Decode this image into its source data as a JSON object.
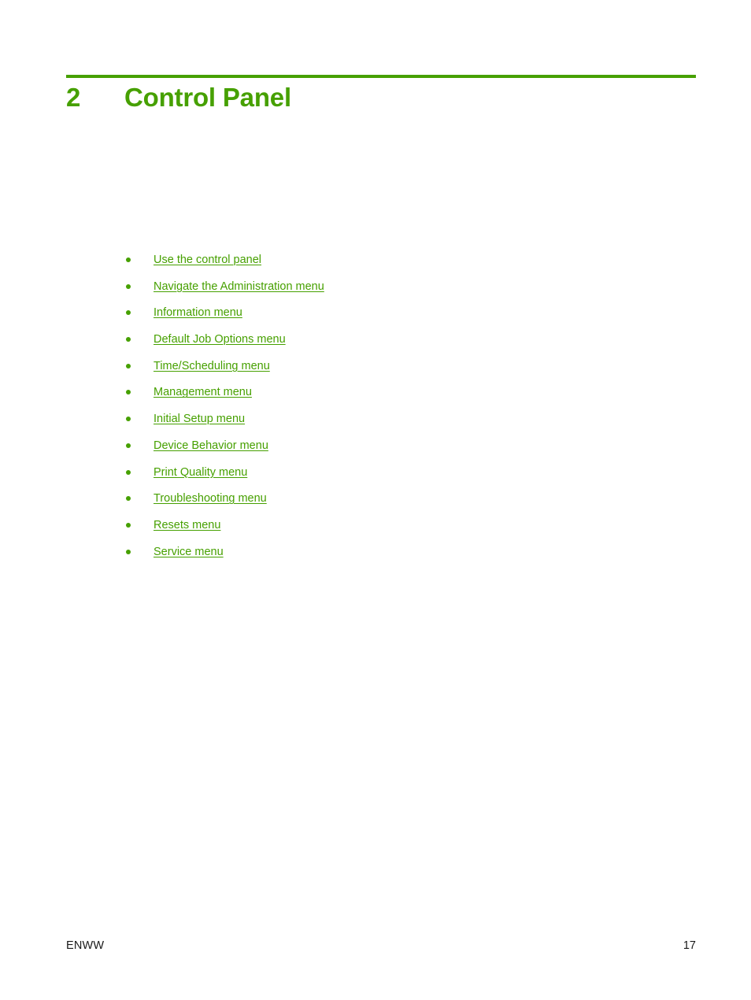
{
  "page": {
    "background_color": "#ffffff",
    "accent_color": "#46a000",
    "text_color": "#1a1a1a"
  },
  "chapter": {
    "number": "2",
    "title": "Control Panel"
  },
  "toc": {
    "items": [
      {
        "label": "Use the control panel"
      },
      {
        "label": "Navigate the Administration menu"
      },
      {
        "label": "Information menu"
      },
      {
        "label": "Default Job Options menu"
      },
      {
        "label": "Time/Scheduling menu"
      },
      {
        "label": "Management menu"
      },
      {
        "label": "Initial Setup menu"
      },
      {
        "label": "Device Behavior menu"
      },
      {
        "label": "Print Quality menu"
      },
      {
        "label": "Troubleshooting menu"
      },
      {
        "label": "Resets menu"
      },
      {
        "label": "Service menu"
      }
    ]
  },
  "footer": {
    "left_label": "ENWW",
    "page_number": "17"
  }
}
